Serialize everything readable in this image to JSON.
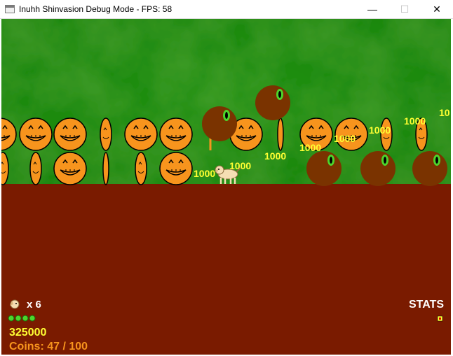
{
  "window": {
    "title": "Inuhh Shinvasion Debug Mode - FPS: 58",
    "minimize_glyph": "—",
    "maximize_glyph": "☐",
    "close_glyph": "✕"
  },
  "hud": {
    "lives": "x 6",
    "health_pips": 4,
    "score": "325000",
    "coins": "Coins: 47 / 100",
    "stats_label": "STATS",
    "life_icon": "dog-head-icon",
    "stats_icon": "red-box-icon"
  },
  "floating_scores": [
    "1000",
    "1000",
    "1000",
    "1000",
    "1000",
    "1000",
    "1000",
    "1000",
    "10"
  ],
  "colors": {
    "sky": "#1c8a0f",
    "ground": "#7a1b00",
    "pumpkin": "#f7941d",
    "eye_blob": "#7a3300",
    "score_text": "#ffff33",
    "coin_text": "#f7941d",
    "health": "#4cd62c"
  }
}
